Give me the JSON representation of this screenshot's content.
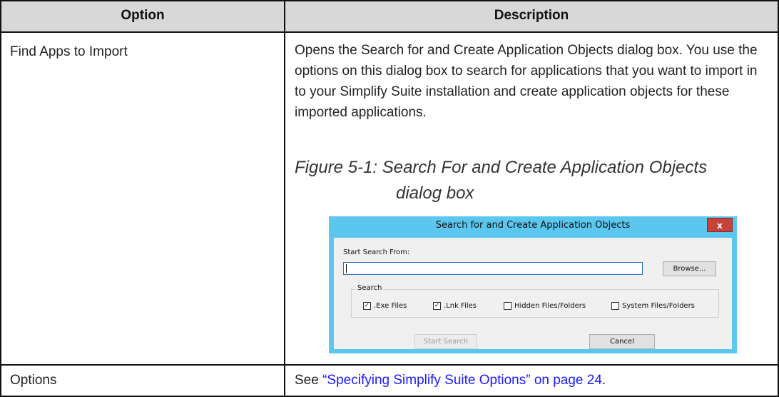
{
  "table": {
    "headers": [
      "Option",
      "Description"
    ],
    "rows": [
      {
        "option": "Find Apps to Import",
        "description": "Opens the Search for and Create Application Objects dialog box. You use the options on this dialog box to search for applications that you want to import in to your Simplify Suite installation and create application objects for these imported applications.",
        "figure_caption_line1": "Figure 5-1:   Search For and Create Application Objects",
        "figure_caption_line2": "dialog box"
      },
      {
        "option": "Options",
        "description_prefix": "See ",
        "description_link": "“Specifying Simplify Suite Options” on page 24",
        "description_suffix": "."
      }
    ]
  },
  "dialog": {
    "title": "Search for and Create Application Objects",
    "close_label": "x",
    "start_search_from_label": "Start Search From:",
    "path_value": "",
    "browse_label": "Browse...",
    "search_group_label": "Search",
    "checkboxes": [
      {
        "label": ".Exe Files",
        "checked": true
      },
      {
        "label": ".Lnk Files",
        "checked": true
      },
      {
        "label": "Hidden Files/Folders",
        "checked": false
      },
      {
        "label": "System Files/Folders",
        "checked": false
      }
    ],
    "start_search_label": "Start Search",
    "cancel_label": "Cancel"
  },
  "colors": {
    "header_bg": "#d8d8d8",
    "dialog_frame": "#5bc6ee",
    "close_button": "#c7423b",
    "link": "#1a1aff"
  }
}
